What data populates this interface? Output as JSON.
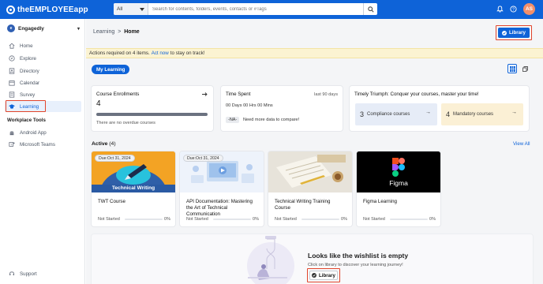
{
  "app": {
    "logo_text": "theEMPLOYEEapp",
    "search_scope": "All",
    "search_placeholder": "Search for contents, folders, events, contacts or #Tags",
    "user_initials": "AS",
    "colors": {
      "brand": "#0e63d8",
      "highlight": "#e1442b",
      "alert_bg": "#fbf3d2",
      "avatar": "#f28f6a"
    }
  },
  "sidebar": {
    "org_name": "Engagedly",
    "items": [
      {
        "label": "Home",
        "icon": "home-icon"
      },
      {
        "label": "Explore",
        "icon": "compass-icon"
      },
      {
        "label": "Directory",
        "icon": "directory-icon"
      },
      {
        "label": "Calendar",
        "icon": "calendar-icon"
      },
      {
        "label": "Survey",
        "icon": "survey-icon"
      },
      {
        "label": "Learning",
        "icon": "graduation-cap-icon",
        "active": true
      }
    ],
    "tools_heading": "Workplace Tools",
    "tools": [
      {
        "label": "Android App",
        "icon": "android-icon"
      },
      {
        "label": "Microsoft Teams",
        "icon": "teams-icon"
      }
    ],
    "support_label": "Support"
  },
  "main": {
    "breadcrumb": {
      "parent": "Learning",
      "separator": ">",
      "current": "Home"
    },
    "library_label": "Library",
    "alert": {
      "prefix": "Actions required on 4 items.",
      "link": "Act now",
      "suffix": "to stay on track!"
    },
    "my_learning_label": "My Learning",
    "enrollments": {
      "title": "Course Enrollments",
      "count": "4",
      "progress": 1.0,
      "note": "There are no overdue courses"
    },
    "time_spent": {
      "title": "Time Spent",
      "range": "last 90 days",
      "value": "00 Days 00 Hrs 00 Mins",
      "badge": "-NA-",
      "note": "Need more data to compare!"
    },
    "triumph": {
      "title": "Timely Triumph: Conquer your courses, master your time!",
      "compliance": {
        "count": "3",
        "label": "Compliance courses"
      },
      "mandatory": {
        "count": "4",
        "label": "Mandatory courses"
      }
    },
    "active": {
      "label": "Active",
      "count": "(4)",
      "view_all": "View All"
    },
    "courses": [
      {
        "due": "Due:Oct 31, 2024",
        "title": "TWT Course",
        "status": "Not Started",
        "progress": 0,
        "percent": "0%",
        "thumb_label": "Technical Writing"
      },
      {
        "due": "Due:Oct 31, 2024",
        "title": "API Documentation: Mastering the Art of Technical Communication",
        "status": "Not Started",
        "progress": 0,
        "percent": "0%"
      },
      {
        "title": "Technical Writing Training Course",
        "status": "Not Started",
        "progress": 0,
        "percent": "0%"
      },
      {
        "title": "Figma Learning",
        "status": "Not Started",
        "progress": 0,
        "percent": "0%",
        "thumb_label": "Figma"
      }
    ],
    "wishlist": {
      "title": "Looks like the wishlist is empty",
      "subtitle": "Click on library to discover your learning journey!",
      "button": "Library"
    }
  }
}
